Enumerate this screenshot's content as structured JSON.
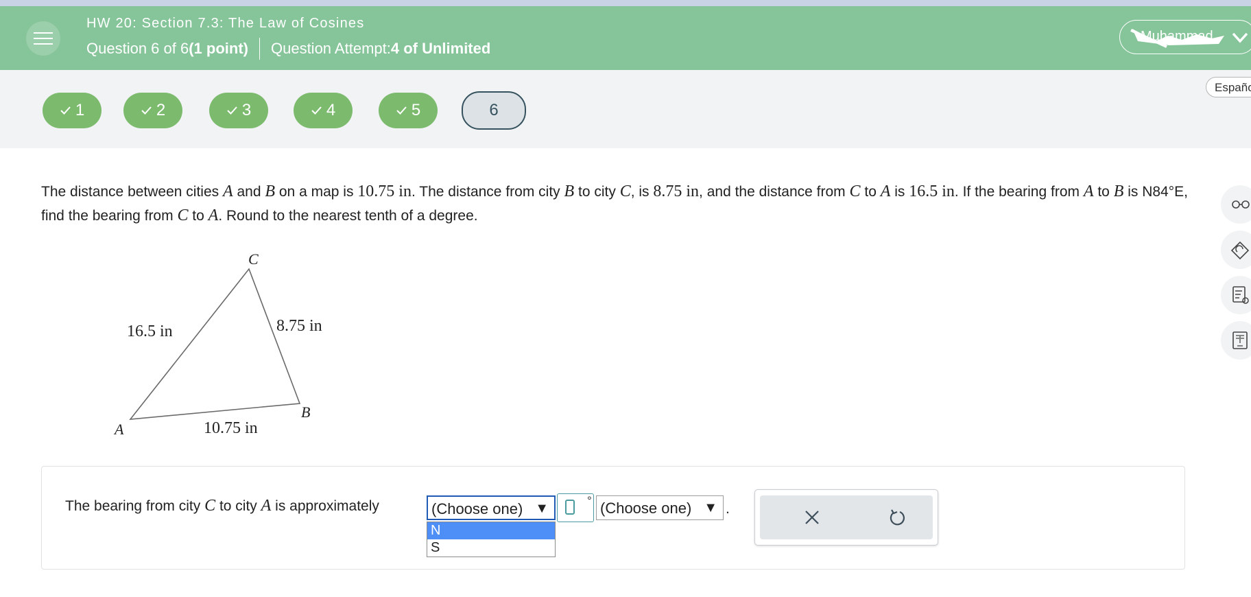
{
  "header": {
    "hw_title": "HW 20: Section 7.3: The Law of Cosines",
    "question_prefix": "Question 6 of 6 ",
    "question_points": "(1 point)",
    "attempt_prefix": "Question Attempt: ",
    "attempt_value": "4 of Unlimited",
    "user_label": "Muhammad"
  },
  "nav": {
    "questions": [
      {
        "label": "1",
        "status": "correct"
      },
      {
        "label": "2",
        "status": "correct"
      },
      {
        "label": "3",
        "status": "correct"
      },
      {
        "label": "4",
        "status": "correct"
      },
      {
        "label": "5",
        "status": "correct"
      },
      {
        "label": "6",
        "status": "current"
      }
    ],
    "language": "Español"
  },
  "question": {
    "t1": "The distance between cities ",
    "A": "A",
    "t2": " and ",
    "B": "B",
    "t3": " on a map is ",
    "ab": "10.75 in",
    "t4": ". The distance from city ",
    "t5": " to city ",
    "C": "C",
    "t6": ", is ",
    "bc": "8.75 in",
    "t7": ", and the distance from ",
    "t8": " to ",
    "t9": " is ",
    "ca": "16.5 in",
    "t10": ". If the bearing from ",
    "t11": " to ",
    "t12": " is N84°E, find the bearing from ",
    "t13": " to ",
    "t14": ". Round to the nearest tenth of a degree."
  },
  "diagram": {
    "vertex_a": "A",
    "vertex_b": "B",
    "vertex_c": "C",
    "side_ca": "16.5 in",
    "side_bc": "8.75 in",
    "side_ab": "10.75 in"
  },
  "answer": {
    "p1": "The bearing from city ",
    "C": "C",
    "p2": " to city ",
    "A": "A",
    "p3": " is approximately",
    "dropdown1_value": "(Choose one)",
    "dropdown2_value": "(Choose one)",
    "degree_symbol": "°",
    "period": ".",
    "dropdown_options": [
      "N",
      "S"
    ],
    "selected_option": "N"
  },
  "colors": {
    "header_bg": "#86c49a",
    "correct_badge": "#7cbb6e",
    "current_badge_border": "#35525e",
    "dropdown_focus": "#1f5bb5",
    "option_highlight": "#4e8ef7"
  }
}
